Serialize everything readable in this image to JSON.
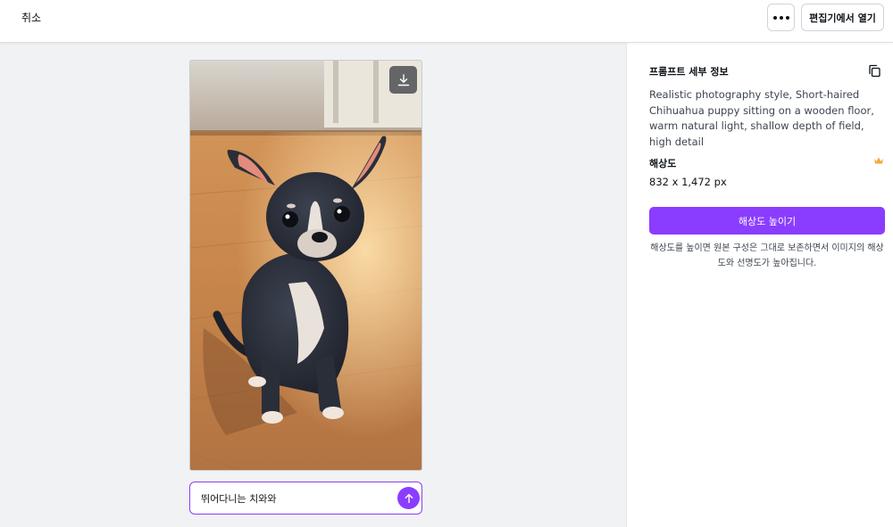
{
  "topbar": {
    "cancel_label": "취소",
    "more_icon": "more-horizontal-icon",
    "open_editor_label": "편집기에서 열기"
  },
  "image": {
    "alt": "Short-haired Chihuahua puppy sitting on a wooden floor",
    "download_icon": "download-icon"
  },
  "prompt_box": {
    "value": "뛰어다니는 치와와",
    "send_icon": "arrow-up-icon"
  },
  "panel": {
    "prompt_title": "프롬프트 세부 정보",
    "copy_icon": "copy-icon",
    "prompt_text": "Realistic photography style, Short-haired Chihuahua puppy sitting on a wooden floor, warm natural light, shallow depth of field, high detail",
    "resolution_title": "해상도",
    "crown_icon": "crown-icon",
    "resolution_value": "832 x 1,472 px",
    "upscale_label": "해상도 높이기",
    "upscale_description": "해상도를 높이면 원본 구성은 그대로 보존하면서 이미지의 해상도와 선명도가 높아집니다."
  },
  "colors": {
    "accent": "#8b3dff",
    "crown": "#f2a93b",
    "canvas_bg": "#f1f2f4"
  }
}
